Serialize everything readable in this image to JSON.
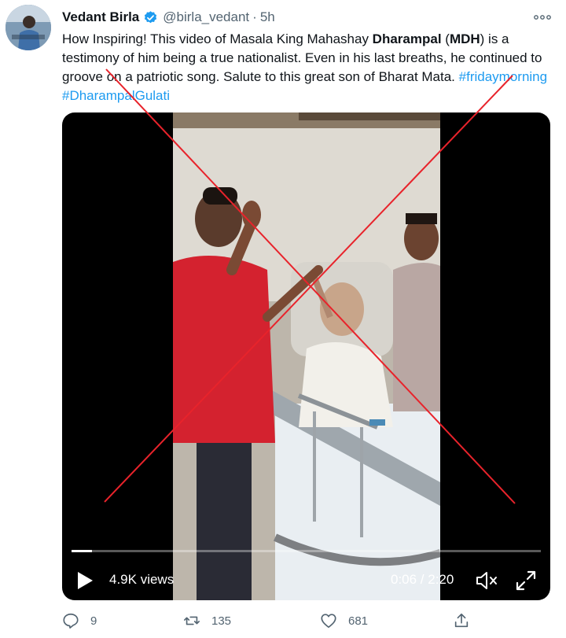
{
  "author": {
    "name": "Vedant Birla",
    "handle": "@birla_vedant",
    "separator": "·",
    "time": "5h"
  },
  "tweet": {
    "text_part1": "How Inspiring! This video of Masala King Mahashay ",
    "bold1": "Dharampal",
    "text_part2": " (",
    "bold2": "MDH",
    "text_part3": ") is a testimony of him being a true nationalist. Even in his last breaths, he continued to groove on a patriotic song. Salute to this great son of Bharat Mata. ",
    "hashtag1": "#fridaymorning",
    "hashtag2": "#DharampalGulati"
  },
  "video": {
    "views": "4.9K views",
    "time_display": "0:06 / 2:20",
    "progress": 0.043
  },
  "actions": {
    "replies": "9",
    "retweets": "135",
    "likes": "681"
  },
  "icons": {
    "verified": "verified-badge-icon",
    "more": "more-options-icon",
    "play": "play-icon",
    "mute": "mute-icon",
    "fullscreen": "fullscreen-icon",
    "reply": "reply-icon",
    "retweet": "retweet-icon",
    "like": "like-icon",
    "share": "share-icon"
  },
  "colors": {
    "accent": "#1d9bf0",
    "cross": "#e8232b",
    "muted": "#536471"
  }
}
